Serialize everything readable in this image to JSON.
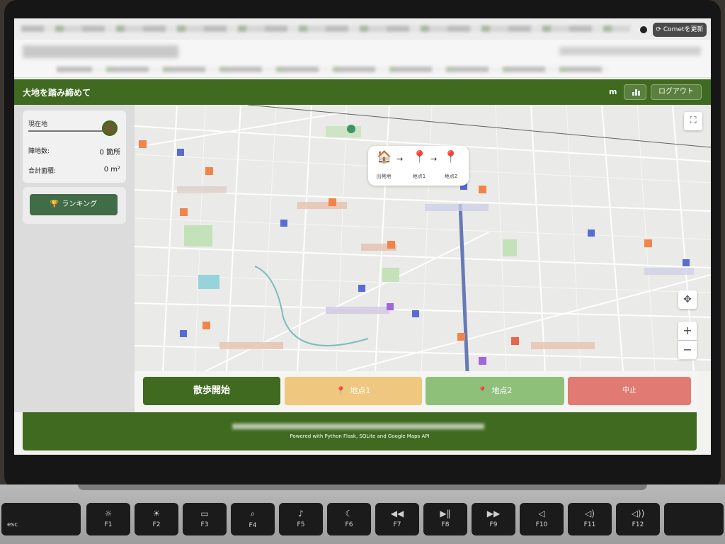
{
  "browser": {
    "reload_button": "Cometを更新"
  },
  "app": {
    "title": "大地を踏み締めて",
    "user_initial": "m",
    "logout_label": "ログアウト"
  },
  "sidebar": {
    "current_location_label": "現在地",
    "stats": [
      {
        "label": "陣地数:",
        "value": "0 箇所"
      },
      {
        "label": "合計面積:",
        "value": "0 m²"
      }
    ],
    "ranking_label": "ランキング"
  },
  "route": {
    "steps": [
      {
        "label": "出発地",
        "icon": "house-icon"
      },
      {
        "label": "地点1",
        "icon": "pin-icon"
      },
      {
        "label": "地点2",
        "icon": "pin-icon"
      }
    ],
    "arrow": "→"
  },
  "map_controls": {
    "fullscreen": "⛶",
    "pan": "✥",
    "zoom_in": "+",
    "zoom_out": "−"
  },
  "actions": {
    "start": "散歩開始",
    "point1": "地点1",
    "point2": "地点2",
    "stop": "中止"
  },
  "footer": {
    "powered_by": "Powered with Python Flask, SQLite and Google Maps API"
  },
  "keyboard": {
    "keys": [
      "esc",
      "F1",
      "F2",
      "F3",
      "F4",
      "F5",
      "F6",
      "F7",
      "F8",
      "F9",
      "F10",
      "F11",
      "F12"
    ]
  },
  "colors": {
    "brand_green": "#3f6a1f",
    "point1_orange": "#f0c77f",
    "point2_green": "#8fc07a",
    "stop_red": "#e07a72",
    "ranking_green": "#416c48"
  }
}
